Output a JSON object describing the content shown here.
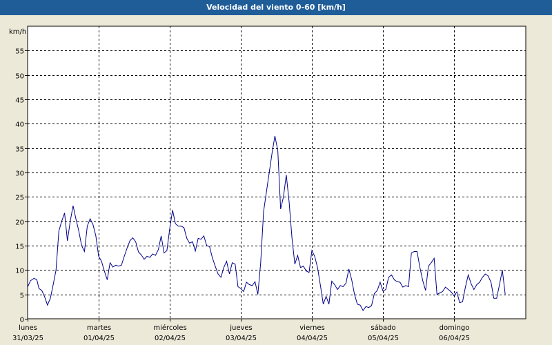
{
  "window": {
    "title": "Velocidad del viento 0-60 [km/h]"
  },
  "chart_data": {
    "type": "line",
    "title": "Velocidad del viento 0-60 [km/h]",
    "ylabel": "km/h",
    "ylim": [
      0,
      60
    ],
    "yticks": [
      0,
      5,
      10,
      15,
      20,
      25,
      30,
      35,
      40,
      45,
      50,
      55
    ],
    "grid": true,
    "x_days": [
      {
        "day": "lunes",
        "date": "31/03/25"
      },
      {
        "day": "martes",
        "date": "01/04/25"
      },
      {
        "day": "miércoles",
        "date": "02/04/25"
      },
      {
        "day": "jueves",
        "date": "03/04/25"
      },
      {
        "day": "viernes",
        "date": "04/04/25"
      },
      {
        "day": "sábado",
        "date": "05/04/25"
      },
      {
        "day": "domingo",
        "date": "06/04/25"
      }
    ],
    "xlim_days": [
      0,
      7.0
    ],
    "series": [
      {
        "color": "#00008b",
        "points": [
          [
            0.0,
            6.5
          ],
          [
            0.04,
            7.8
          ],
          [
            0.09,
            8.3
          ],
          [
            0.13,
            8.0
          ],
          [
            0.16,
            6.2
          ],
          [
            0.2,
            5.8
          ],
          [
            0.24,
            4.5
          ],
          [
            0.28,
            2.8
          ],
          [
            0.32,
            4.2
          ],
          [
            0.36,
            7.0
          ],
          [
            0.4,
            10.0
          ],
          [
            0.44,
            18.0
          ],
          [
            0.48,
            20.0
          ],
          [
            0.52,
            21.7
          ],
          [
            0.56,
            16.0
          ],
          [
            0.6,
            20.0
          ],
          [
            0.64,
            23.2
          ],
          [
            0.68,
            20.5
          ],
          [
            0.72,
            18.0
          ],
          [
            0.76,
            15.0
          ],
          [
            0.8,
            13.8
          ],
          [
            0.84,
            19.0
          ],
          [
            0.88,
            20.5
          ],
          [
            0.92,
            19.3
          ],
          [
            0.96,
            17.0
          ],
          [
            1.0,
            12.8
          ],
          [
            1.04,
            11.8
          ],
          [
            1.08,
            9.8
          ],
          [
            1.12,
            8.0
          ],
          [
            1.16,
            11.5
          ],
          [
            1.2,
            10.6
          ],
          [
            1.24,
            11.0
          ],
          [
            1.28,
            10.8
          ],
          [
            1.32,
            11.0
          ],
          [
            1.36,
            12.8
          ],
          [
            1.4,
            14.5
          ],
          [
            1.44,
            16.0
          ],
          [
            1.48,
            16.6
          ],
          [
            1.52,
            15.8
          ],
          [
            1.56,
            13.7
          ],
          [
            1.6,
            13.1
          ],
          [
            1.64,
            12.2
          ],
          [
            1.68,
            12.8
          ],
          [
            1.72,
            12.6
          ],
          [
            1.76,
            13.3
          ],
          [
            1.8,
            13.0
          ],
          [
            1.84,
            14.2
          ],
          [
            1.88,
            17.0
          ],
          [
            1.92,
            13.5
          ],
          [
            1.96,
            14.0
          ],
          [
            2.0,
            18.5
          ],
          [
            2.04,
            22.3
          ],
          [
            2.08,
            19.5
          ],
          [
            2.12,
            19.0
          ],
          [
            2.16,
            19.0
          ],
          [
            2.2,
            18.7
          ],
          [
            2.24,
            16.5
          ],
          [
            2.28,
            15.5
          ],
          [
            2.32,
            15.8
          ],
          [
            2.36,
            13.9
          ],
          [
            2.4,
            16.5
          ],
          [
            2.44,
            16.3
          ],
          [
            2.48,
            17.0
          ],
          [
            2.52,
            15.0
          ],
          [
            2.56,
            14.8
          ],
          [
            2.6,
            12.5
          ],
          [
            2.64,
            10.8
          ],
          [
            2.68,
            9.2
          ],
          [
            2.72,
            8.5
          ],
          [
            2.76,
            10.5
          ],
          [
            2.8,
            11.8
          ],
          [
            2.84,
            9.2
          ],
          [
            2.88,
            11.5
          ],
          [
            2.92,
            11.2
          ],
          [
            2.96,
            6.6
          ],
          [
            3.0,
            6.2
          ],
          [
            3.04,
            5.6
          ],
          [
            3.08,
            7.5
          ],
          [
            3.12,
            7.0
          ],
          [
            3.16,
            6.8
          ],
          [
            3.2,
            7.6
          ],
          [
            3.24,
            5.0
          ],
          [
            3.28,
            11.5
          ],
          [
            3.32,
            22.0
          ],
          [
            3.36,
            26.0
          ],
          [
            3.4,
            30.0
          ],
          [
            3.44,
            34.0
          ],
          [
            3.48,
            37.5
          ],
          [
            3.52,
            34.5
          ],
          [
            3.56,
            22.5
          ],
          [
            3.6,
            25.0
          ],
          [
            3.64,
            29.5
          ],
          [
            3.68,
            24.0
          ],
          [
            3.72,
            16.5
          ],
          [
            3.76,
            11.2
          ],
          [
            3.8,
            13.0
          ],
          [
            3.84,
            10.5
          ],
          [
            3.88,
            10.8
          ],
          [
            3.92,
            9.8
          ],
          [
            3.96,
            9.5
          ],
          [
            4.0,
            14.0
          ],
          [
            4.04,
            12.8
          ],
          [
            4.08,
            10.5
          ],
          [
            4.12,
            6.8
          ],
          [
            4.16,
            3.0
          ],
          [
            4.2,
            4.6
          ],
          [
            4.24,
            3.0
          ],
          [
            4.28,
            7.7
          ],
          [
            4.32,
            7.0
          ],
          [
            4.36,
            6.0
          ],
          [
            4.4,
            6.8
          ],
          [
            4.44,
            6.6
          ],
          [
            4.48,
            7.3
          ],
          [
            4.52,
            10.2
          ],
          [
            4.56,
            8.0
          ],
          [
            4.6,
            5.0
          ],
          [
            4.64,
            3.0
          ],
          [
            4.68,
            2.8
          ],
          [
            4.72,
            1.7
          ],
          [
            4.76,
            2.5
          ],
          [
            4.8,
            2.3
          ],
          [
            4.84,
            2.7
          ],
          [
            4.88,
            5.2
          ],
          [
            4.92,
            5.8
          ],
          [
            4.96,
            7.5
          ],
          [
            5.0,
            5.7
          ],
          [
            5.04,
            6.0
          ],
          [
            5.08,
            8.5
          ],
          [
            5.12,
            9.0
          ],
          [
            5.16,
            8.0
          ],
          [
            5.2,
            7.6
          ],
          [
            5.24,
            7.5
          ],
          [
            5.28,
            6.5
          ],
          [
            5.32,
            6.8
          ],
          [
            5.36,
            6.6
          ],
          [
            5.4,
            13.5
          ],
          [
            5.44,
            13.8
          ],
          [
            5.48,
            13.8
          ],
          [
            5.52,
            10.5
          ],
          [
            5.56,
            7.8
          ],
          [
            5.6,
            5.8
          ],
          [
            5.64,
            10.8
          ],
          [
            5.68,
            11.5
          ],
          [
            5.72,
            12.4
          ],
          [
            5.76,
            5.0
          ],
          [
            5.8,
            5.3
          ],
          [
            5.84,
            5.6
          ],
          [
            5.88,
            6.5
          ],
          [
            5.92,
            6.0
          ],
          [
            5.96,
            5.5
          ],
          [
            6.0,
            4.7
          ],
          [
            6.04,
            5.5
          ],
          [
            6.08,
            3.3
          ],
          [
            6.12,
            3.5
          ],
          [
            6.16,
            6.5
          ],
          [
            6.2,
            9.0
          ],
          [
            6.24,
            7.2
          ],
          [
            6.28,
            6.0
          ],
          [
            6.32,
            7.0
          ],
          [
            6.36,
            7.5
          ],
          [
            6.4,
            8.5
          ],
          [
            6.44,
            9.2
          ],
          [
            6.48,
            8.8
          ],
          [
            6.52,
            7.5
          ],
          [
            6.56,
            4.2
          ],
          [
            6.6,
            4.2
          ],
          [
            6.64,
            7.0
          ],
          [
            6.68,
            10.0
          ],
          [
            6.72,
            5.0
          ]
        ]
      }
    ]
  }
}
